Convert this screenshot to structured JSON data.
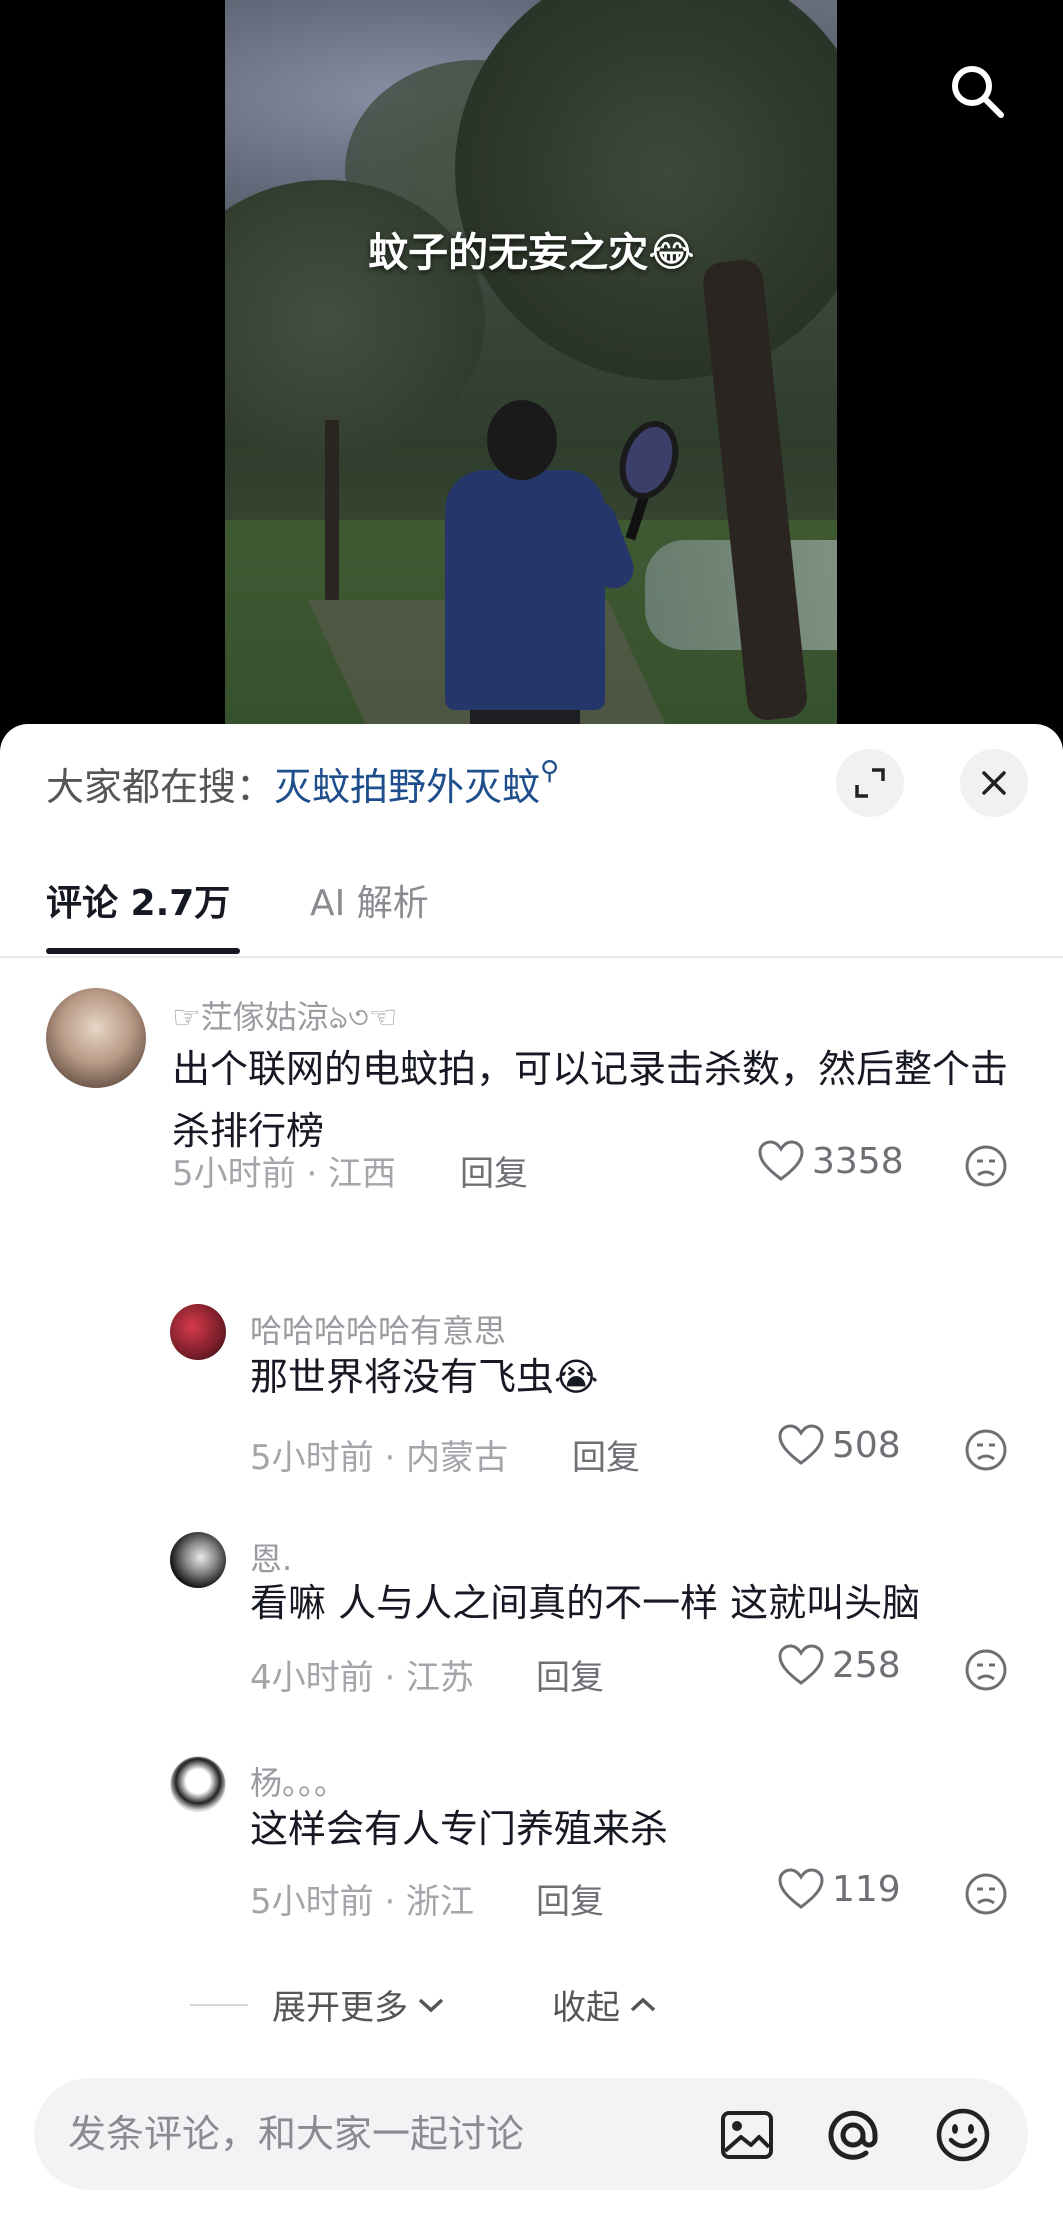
{
  "video": {
    "caption": "蚊子的无妄之灾😂"
  },
  "search_suggest": {
    "prefix": "大家都在搜：",
    "keyword": "灭蚊拍野外灭蚊"
  },
  "tabs": [
    {
      "label": "评论 2.7万",
      "active": true
    },
    {
      "label": "AI 解析",
      "active": false
    }
  ],
  "comments": [
    {
      "username": "☞茳傢姑涼ঌ৩☜",
      "text": "出个联网的电蚊拍，可以记录击杀数，然后整个击杀排行榜",
      "time_location": "5小时前 · 江西",
      "reply_label": "回复",
      "likes": "3358"
    },
    {
      "username": "哈哈哈哈哈有意思",
      "text": "那世界将没有飞虫😭",
      "time_location": "5小时前 · 内蒙古",
      "reply_label": "回复",
      "likes": "508"
    },
    {
      "username": "恩.",
      "text": "看嘛 人与人之间真的不一样 这就叫头脑",
      "time_location": "4小时前 · 江苏",
      "reply_label": "回复",
      "likes": "258"
    },
    {
      "username": "杨。。。",
      "text": "这样会有人专门养殖来杀",
      "time_location": "5小时前 · 浙江",
      "reply_label": "回复",
      "likes": "119"
    }
  ],
  "thread_controls": {
    "expand_more": "展开更多",
    "collapse": "收起"
  },
  "input": {
    "placeholder": "发条评论，和大家一起讨论"
  },
  "icons": {
    "search": "search-icon",
    "expand": "expand-icon",
    "close": "close-icon",
    "like": "heart-icon",
    "dislike": "dislike-face-icon",
    "image": "image-icon",
    "mention": "at-icon",
    "emoji": "emoji-icon"
  }
}
